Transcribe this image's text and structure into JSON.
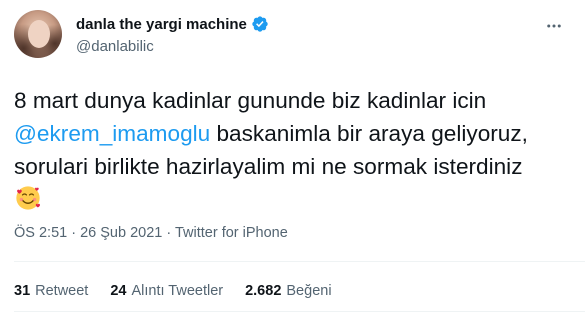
{
  "author": {
    "display_name": "danla the yargi machine",
    "handle": "@danlabilic",
    "verified": true
  },
  "tweet": {
    "line1": "8 mart dunya kadinlar gununde biz kadinlar icin",
    "mention": "@ekrem_imamoglu",
    "line2_rest": " baskanimla bir araya geliyoruz,",
    "line3": "sorulari birlikte hazirlayalim mi ne sormak isterdiniz",
    "emoji": "smiling-face-with-hearts"
  },
  "meta": {
    "time": "ÖS 2:51",
    "sep1": " · ",
    "date": "26 Şub 2021",
    "sep2": " · ",
    "source": "Twitter for iPhone"
  },
  "stats": {
    "retweets_count": "31",
    "retweets_label": "Retweet",
    "quotes_count": "24",
    "quotes_label": "Alıntı Tweetler",
    "likes_count": "2.682",
    "likes_label": "Beğeni"
  },
  "colors": {
    "accent": "#1d9bf0",
    "text": "#0f1419",
    "muted": "#536471"
  },
  "icons": {
    "verified": "verified-badge-icon",
    "more": "more-icon"
  }
}
